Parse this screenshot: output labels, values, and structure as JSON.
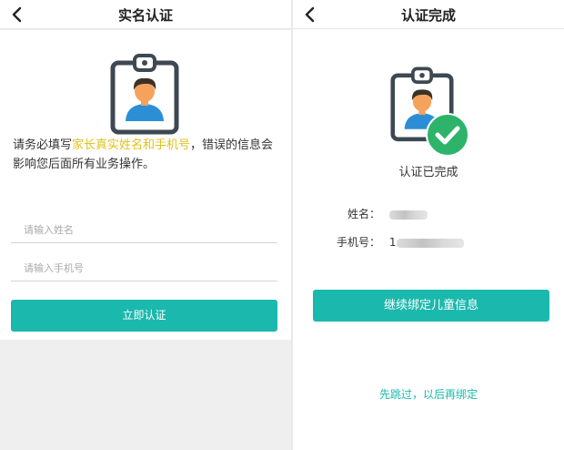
{
  "left": {
    "title": "实名认证",
    "notice_before": "请务必填写",
    "notice_highlight": "家长真实姓名和手机号",
    "notice_after": "，错误的信息会影响您后面所有业务操作。",
    "name_placeholder": "请输入姓名",
    "phone_placeholder": "请输入手机号",
    "submit_label": "立即认证"
  },
  "right": {
    "title": "认证完成",
    "status_text": "认证已完成",
    "name_label": "姓名：",
    "phone_label": "手机号：",
    "phone_visible_prefix": "1",
    "continue_label": "继续绑定儿童信息",
    "skip_label": "先跳过，以后再绑定"
  },
  "icons": {
    "back": "chevron-left-icon",
    "id_badge": "id-badge-icon",
    "check": "check-circle-icon"
  },
  "colors": {
    "accent": "#1bb8ad",
    "highlight": "#e0c21a",
    "badge_outline": "#3d4852",
    "avatar_skin": "#f5a25d",
    "avatar_hair": "#3a3226",
    "avatar_shirt": "#2c8fd6",
    "check_green": "#2db46a"
  }
}
